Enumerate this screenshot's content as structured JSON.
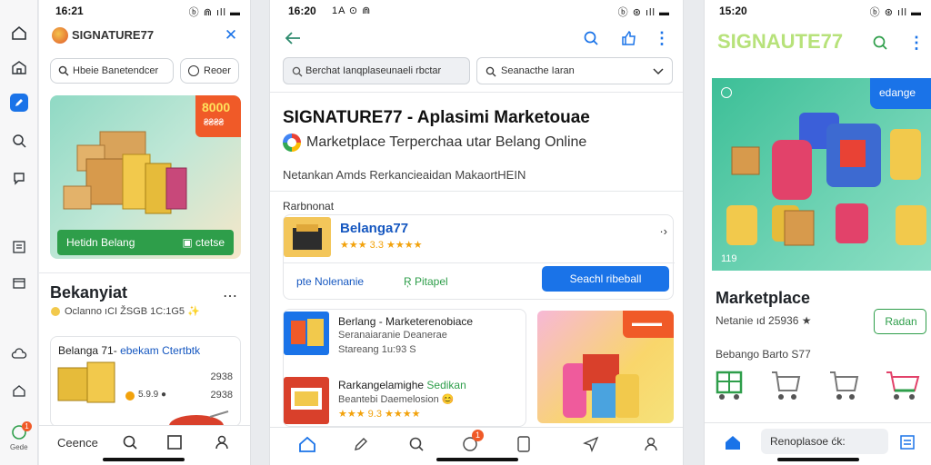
{
  "panel1": {
    "status_time": "16:21",
    "status_icons": "ⓑ ⋒ ıll ▬",
    "app_title": "SIGNATURE77",
    "search_placeholder": "Hbeie Banetendcer",
    "filter_label": "Reoer",
    "promo_badge": "8000",
    "promo_badge_sub": "₴₴₴₴",
    "promo_cta": "Hetidn Belang",
    "promo_cta_right": "▣ ctetse",
    "section_title": "Bekanyiat",
    "section_meta": "Oclanno ıCI ŽSGB 1C:1G5 ✨",
    "card_title": "Belanga 71- ",
    "card_title_highlight": "ebekam Ctertbtk",
    "card_value": "2938",
    "card_rating": "5.9.9 ●",
    "card_value2": "2938",
    "bottom_search": "Ceence",
    "rail_badge": "1",
    "rail_label": "Gede"
  },
  "panel2": {
    "status_time": "16:20",
    "status_icons": "1A ⊙ ⋒",
    "status_right": "ⓑ ⊛ ıll ▬",
    "search_chip": "Berchat Ianqplaseunaeli rbctar",
    "select_value": "Seanacthe Iaran",
    "headline": "SIGNATURE77 - Aplasimi Marketouae",
    "subhead": "Marketplace Terperchaa utar Belang Online",
    "description": "Netankan Amds Rerkancieaidan MakaortHEIN",
    "section_label": "Rarbnonat",
    "listing_title": "Belanga77",
    "listing_rating": "★★★ 3.3 ★★★★",
    "listing_more": "·›",
    "action_left": "pte Nolenanie",
    "action_mid": "Ŗ Pitapel",
    "action_button": "Seachl ribeball",
    "item1_title": "Berlang - Marketerenobiace",
    "item1_sub": "Seranaiaranie Deanerae",
    "item1_price": "Stareang 1u:93 S",
    "item2_title": "Rarkangelamighe ",
    "item2_title_highlight": "Sedikan",
    "item2_sub": "Beantebi Daemelosion 😊",
    "item2_rating": "★★★ 9.3 ★★★★",
    "promo_tag": "▬▬▬",
    "nav_badge": "1"
  },
  "panel3": {
    "status_time": "15:20",
    "status_icons": "ⓑ ⊛ ıll ▬",
    "app_title": "SIGNAUTE77",
    "hero_chip": "edange",
    "hero_counter": "119",
    "section_title": "Marketplace",
    "section_meta": "Netanie ıd 25936 ★",
    "outline_button": "Radan",
    "sub_label": "Bebango Barto S77",
    "bottom_search": "Renoplasoe ćk:"
  },
  "colors": {
    "accent": "#1a73e8",
    "green": "#2e9e4a",
    "orange": "#f05a28",
    "title_blue": "#1557c0"
  }
}
